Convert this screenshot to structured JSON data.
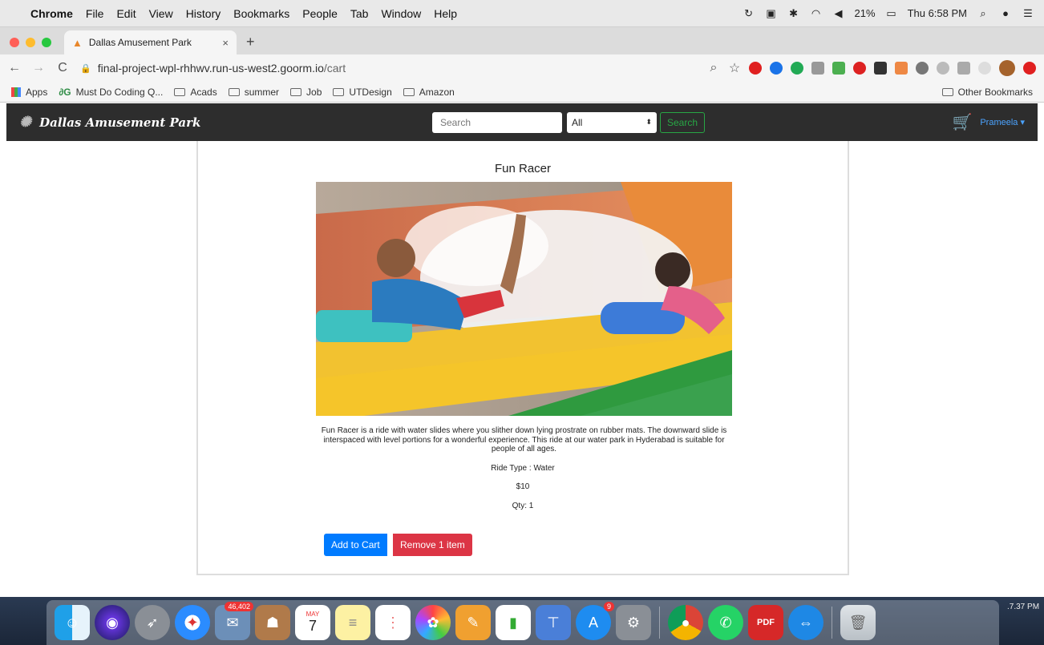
{
  "menubar": {
    "app": "Chrome",
    "items": [
      "File",
      "Edit",
      "View",
      "History",
      "Bookmarks",
      "People",
      "Tab",
      "Window",
      "Help"
    ],
    "battery": "21%",
    "clock": "Thu 6:58 PM"
  },
  "tab": {
    "title": "Dallas Amusement Park",
    "close": "×",
    "new_tab": "+"
  },
  "address": {
    "host": "final-project-wpl-rhhwv.run-us-west2.goorm.io",
    "path": "/cart"
  },
  "bookmarks": {
    "items": [
      "Apps",
      "Must Do Coding Q...",
      "Acads",
      "summer",
      "Job",
      "UTDesign",
      "Amazon"
    ],
    "other": "Other Bookmarks"
  },
  "site": {
    "brand": "Dallas Amusement Park",
    "search_placeholder": "Search",
    "category_selected": "All",
    "search_button": "Search",
    "user": "Prameela"
  },
  "ride": {
    "title": "Fun Racer",
    "description": "Fun Racer is a ride with water slides where you slither down lying prostrate on rubber mats. The downward slide is interspaced with level portions for a wonderful experience. This ride at our water park in Hyderabad is suitable for people of all ages.",
    "type_label": "Ride Type : ",
    "type_value": "Water",
    "price": "$10",
    "qty_label": "Qty: ",
    "qty_value": "1",
    "add_button": "Add to Cart",
    "remove_button": "Remove 1 item"
  },
  "dock": {
    "badges": {
      "mail": "46,402",
      "calendar_month": "MAY",
      "calendar_day": "7",
      "appstore": "9"
    },
    "clock_fragment": ".7.37 PM"
  },
  "colors": {
    "navbar_bg": "#2d2d2d",
    "search_green": "#28a745",
    "add_blue": "#007bff",
    "remove_red": "#dc3545",
    "user_blue": "#4ba3ff"
  }
}
